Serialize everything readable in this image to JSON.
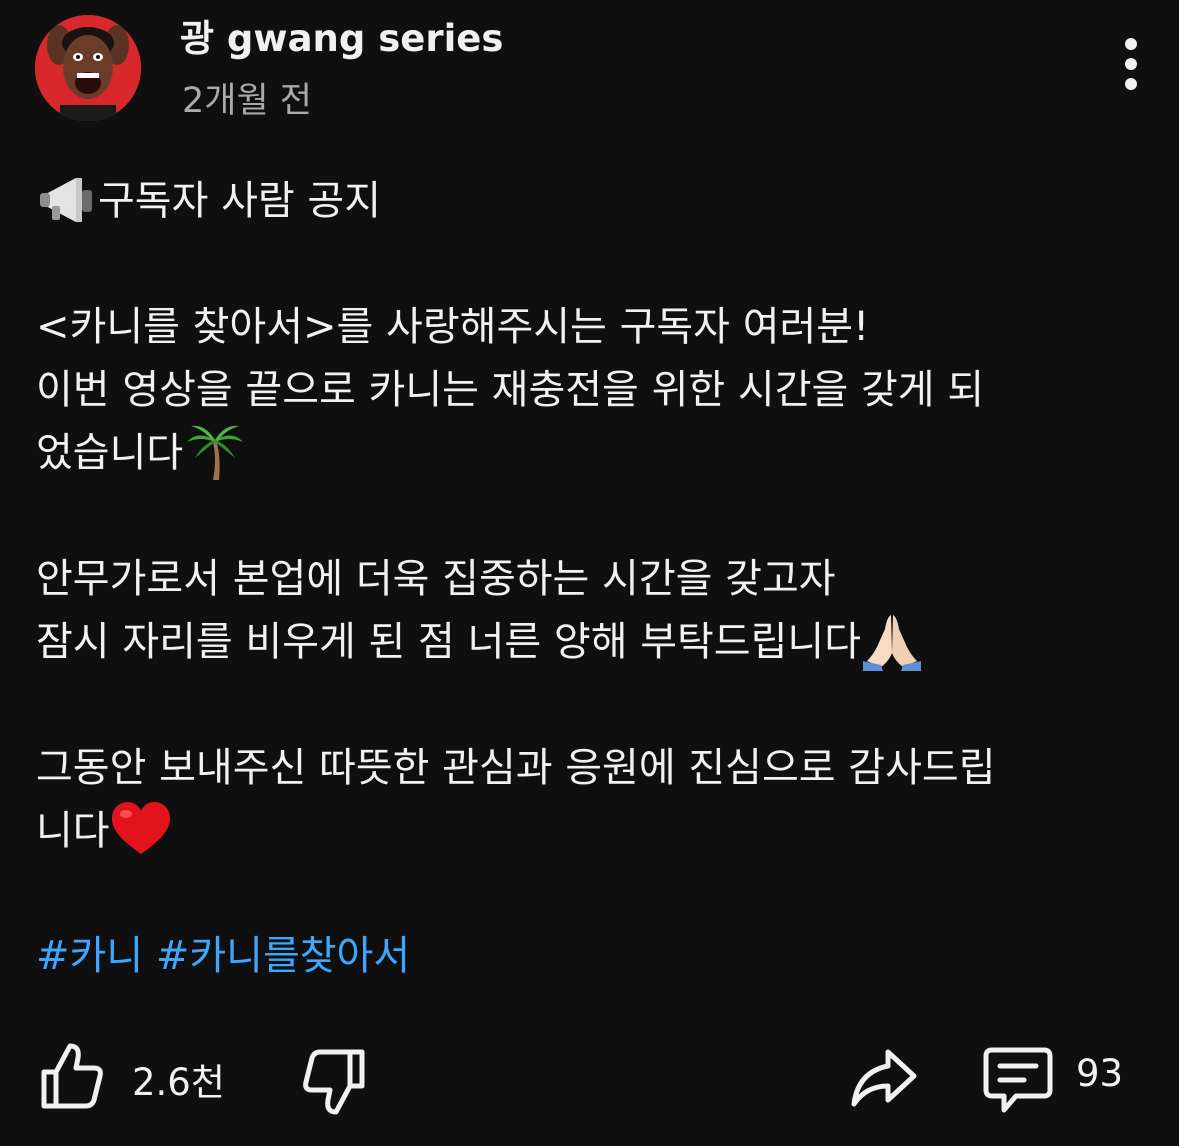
{
  "post": {
    "channel_name": "광 gwang series",
    "time_ago": "2개월 전",
    "lines": {
      "title": "구독자 사람 공지",
      "p1_line1": "<카니를 찾아서>를 사랑해주시는 구독자 여러분!",
      "p1_line2": "이번 영상을 끝으로 카니는 재충전을 위한 시간을 갖게 되",
      "p1_line3": "었습니다",
      "p2_line1": "안무가로서 본업에 더욱 집중하는 시간을 갖고자",
      "p2_line2": "잠시 자리를 비우게 된 점 너른 양해 부탁드립니다",
      "p3_line1": "그동안 보내주신 따뜻한 관심과 응원에 진심으로 감사드립",
      "p3_line2": "니다"
    },
    "hashtags": [
      "#카니",
      "#카니를찾아서"
    ]
  },
  "actions": {
    "like_count": "2.6천",
    "comment_count": "93"
  },
  "icons": {
    "more": "vertical-ellipsis-icon",
    "like": "thumbs-up-icon",
    "dislike": "thumbs-down-icon",
    "share": "share-arrow-icon",
    "comment": "comment-bubble-icon",
    "megaphone": "megaphone-emoji",
    "palm": "palm-tree-emoji",
    "pray": "folded-hands-emoji",
    "heart": "red-heart-emoji"
  },
  "colors": {
    "background": "#0f0f0f",
    "text": "#f1f1f1",
    "secondary_text": "#aaaaaa",
    "hashtag": "#3ea6ff"
  }
}
